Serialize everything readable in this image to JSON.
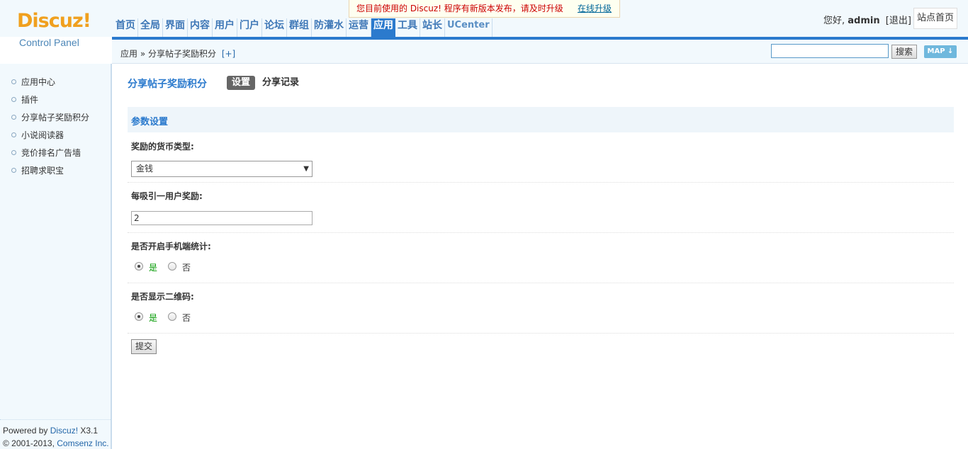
{
  "header": {
    "logo_text": "Discuz!",
    "logo_sub": "Control Panel",
    "nav": [
      "首页",
      "全局",
      "界面",
      "内容",
      "用户",
      "门户",
      "论坛",
      "群组",
      "防灌水",
      "运营",
      "应用",
      "工具",
      "站长",
      "UCenter"
    ],
    "active_nav": "应用",
    "notice_text": "您目前使用的 Discuz! 程序有新版本发布，请及时升级",
    "notice_link": "在线升级",
    "greeting": "您好,",
    "username": "admin",
    "logout": "[退出]",
    "site_home": "站点首页"
  },
  "crumbbar": {
    "crumb": "应用 » 分享帖子奖励积分",
    "plus": "[+]",
    "search_button": "搜索",
    "map_button": "MAP ↓"
  },
  "sidebar": {
    "items": [
      "应用中心",
      "插件",
      "分享帖子奖励积分",
      "小说阅读器",
      "竞价排名广告墙",
      "招聘求职宝"
    ]
  },
  "footer": {
    "powered_prefix": "Powered by ",
    "powered_link": "Discuz!",
    "powered_version": " X3.1",
    "copyright_prefix": "© 2001-2013, ",
    "copyright_link": "Comsenz Inc."
  },
  "main": {
    "title": "分享帖子奖励积分",
    "tab_setting": "设置",
    "tab_record": "分享记录",
    "section_title": "参数设置",
    "currency_label": "奖励的货币类型:",
    "currency_value": "金钱",
    "reward_label": "每吸引一用户奖励:",
    "reward_value": "2",
    "mobile_stat_label": "是否开启手机端统计:",
    "qrcode_label": "是否显示二维码:",
    "yes": "是",
    "no": "否",
    "mobile_stat_selected": "是",
    "qrcode_selected": "是",
    "submit": "提交"
  }
}
